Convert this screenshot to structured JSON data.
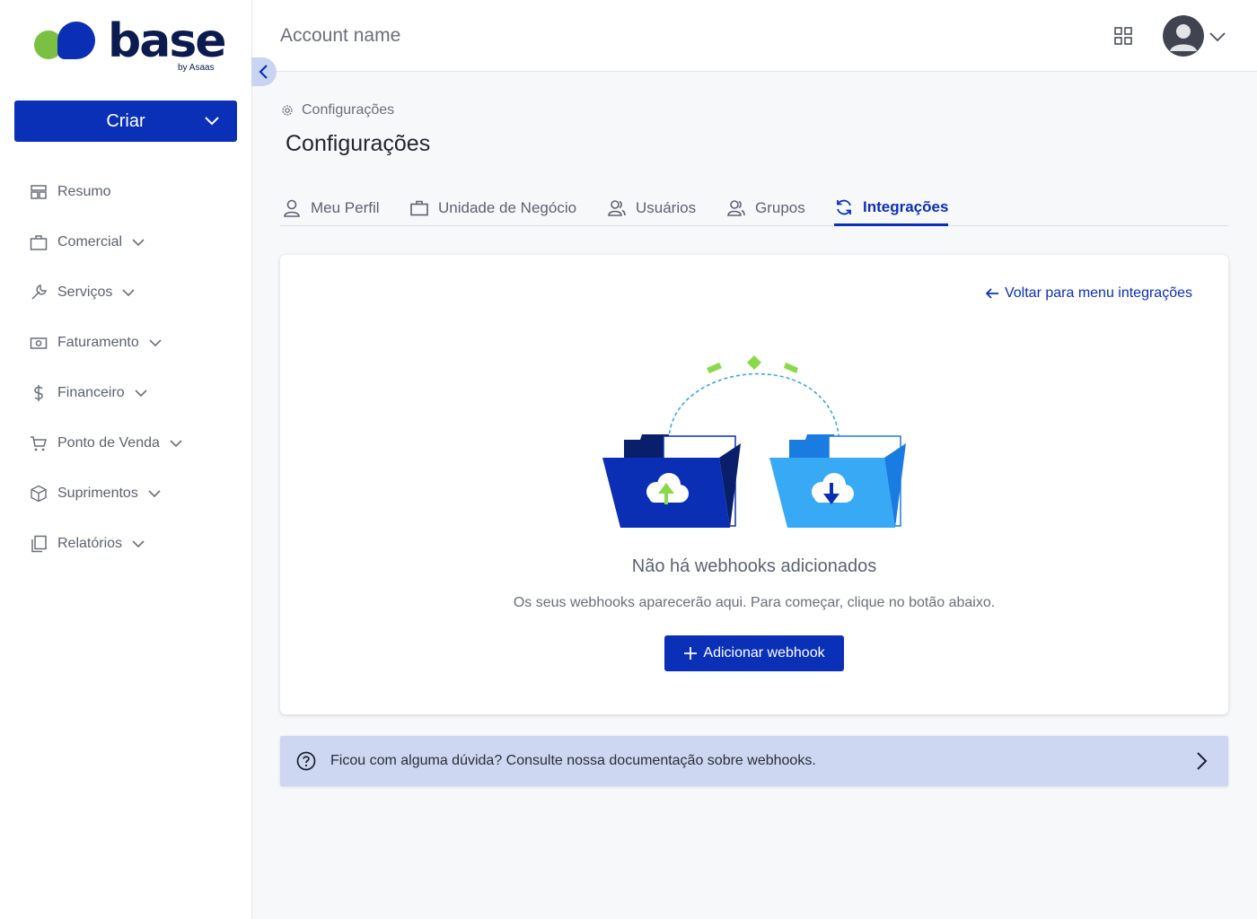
{
  "brand": {
    "name": "base",
    "tagline": "by Asaas"
  },
  "sidebar": {
    "create_label": "Criar",
    "items": [
      {
        "label": "Resumo",
        "icon": "dashboard-icon",
        "expandable": false
      },
      {
        "label": "Comercial",
        "icon": "briefcase-icon",
        "expandable": true
      },
      {
        "label": "Serviços",
        "icon": "wrench-icon",
        "expandable": true
      },
      {
        "label": "Faturamento",
        "icon": "money-icon",
        "expandable": true
      },
      {
        "label": "Financeiro",
        "icon": "dollar-icon",
        "expandable": true
      },
      {
        "label": "Ponto de Venda",
        "icon": "cart-icon",
        "expandable": true
      },
      {
        "label": "Suprimentos",
        "icon": "box-icon",
        "expandable": true
      },
      {
        "label": "Relatórios",
        "icon": "reports-icon",
        "expandable": true
      }
    ]
  },
  "header": {
    "account_name": "Account name"
  },
  "breadcrumb": {
    "label": "Configurações"
  },
  "page": {
    "title": "Configurações"
  },
  "tabs": [
    {
      "label": "Meu Perfil",
      "icon": "user-icon",
      "active": false
    },
    {
      "label": "Unidade de Negócio",
      "icon": "briefcase-icon",
      "active": false
    },
    {
      "label": "Usuários",
      "icon": "users-icon",
      "active": false
    },
    {
      "label": "Grupos",
      "icon": "users-icon",
      "active": false
    },
    {
      "label": "Integrações",
      "icon": "sync-icon",
      "active": true
    }
  ],
  "card": {
    "back_label": "Voltar para menu integrações",
    "empty_title": "Não há webhooks adicionados",
    "empty_subtitle": "Os seus webhooks aparecerão aqui. Para começar, clique no botão abaixo.",
    "add_label": "Adicionar webhook"
  },
  "help": {
    "text": "Ficou com alguma dúvida? Consulte nossa documentação sobre webhooks."
  },
  "colors": {
    "primary": "#0b30b8",
    "accent_green": "#7ac143",
    "light_blue": "#37a9f5",
    "help_bg": "#cdd7f1"
  }
}
